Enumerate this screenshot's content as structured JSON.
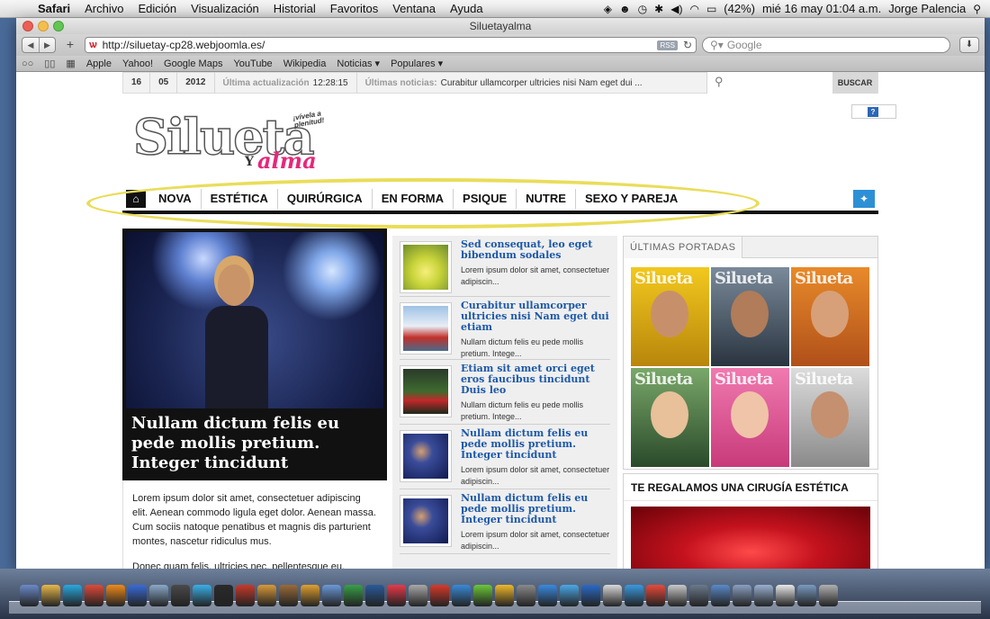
{
  "menubar": {
    "app": "Safari",
    "menus": [
      "Archivo",
      "Edición",
      "Visualización",
      "Historial",
      "Favoritos",
      "Ventana",
      "Ayuda"
    ],
    "battery": "(42%)",
    "datetime": "mié 16 may  01:04 a.m.",
    "user": "Jorge Palencia"
  },
  "browser": {
    "window_title": "Siluetayalma",
    "url": "http://siluetay-cp28.webjoomla.es/",
    "rss_label": "RSS",
    "search_placeholder": "Google",
    "bookmarks": [
      "Apple",
      "Yahoo!",
      "Google Maps",
      "YouTube",
      "Wikipedia",
      "Noticias ▾",
      "Populares ▾"
    ]
  },
  "topstrip": {
    "day": "16",
    "month": "05",
    "year": "2012",
    "update_label": "Última actualización",
    "update_time": "12:28:15",
    "news_label": "Últimas noticias:",
    "news_text": "Curabitur ullamcorper ultricies nisi Nam eget dui ...",
    "search_button": "BUSCAR"
  },
  "logo": {
    "name": "Silueta",
    "y": "Y",
    "alma": "alma",
    "tagline": "¡vívela a plenitud!"
  },
  "help_icon": "?",
  "nav": {
    "items": [
      "NOVA",
      "ESTÉTICA",
      "QUIRÚRGICA",
      "EN FORMA",
      "PSIQUE",
      "NUTRE",
      "SEXO Y PAREJA"
    ]
  },
  "hero": {
    "caption": "Nullam dictum felis eu pede mollis pretium. Integer tincidunt",
    "paragraph1": "Lorem ipsum dolor sit amet, consectetuer adipiscing elit. Aenean commodo ligula eget dolor. Aenean massa. Cum sociis natoque penatibus et magnis dis parturient montes, nascetur ridiculus mus.",
    "paragraph2": "Donec quam felis, ultricies nec, pellentesque eu, pretium"
  },
  "articles": [
    {
      "title": "Sed consequat, leo eget bibendum sodales",
      "excerpt": "Lorem ipsum dolor sit amet, consectetuer adipiscin..."
    },
    {
      "title": "Curabitur ullamcorper ultricies nisi Nam eget dui etiam",
      "excerpt": "Nullam dictum felis eu pede mollis pretium. Intege..."
    },
    {
      "title": "Etiam sit amet orci eget eros faucibus tincidunt Duis leo",
      "excerpt": "Nullam dictum felis eu pede mollis pretium. Intege..."
    },
    {
      "title": "Nullam dictum felis eu pede mollis pretium. Integer tincidunt",
      "excerpt": "Lorem ipsum dolor sit amet, consectetuer adipiscin..."
    },
    {
      "title": "Nullam dictum felis eu pede mollis pretium. Integer tincidunt",
      "excerpt": "Lorem ipsum dolor sit amet, consectetuer adipiscin..."
    }
  ],
  "portadas": {
    "title": "ÚLTIMAS PORTADAS",
    "masthead": "Silueta"
  },
  "regalamos": {
    "title": "TE REGALAMOS UNA CIRUGÍA ESTÉTICA"
  },
  "colors": {
    "link_blue": "#1c58a8",
    "brand_pink": "#e6287a",
    "annotation_yellow": "#e9dd5a",
    "twitter_blue": "#2d8fd5"
  }
}
